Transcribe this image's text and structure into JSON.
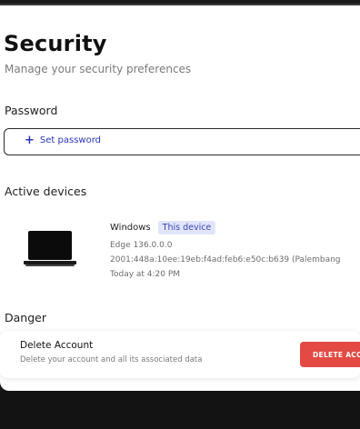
{
  "header": {
    "title": "Security",
    "subtitle": "Manage your security preferences"
  },
  "password": {
    "label": "Password",
    "button_icon": "plus-icon",
    "button_label": "Set password"
  },
  "devices": {
    "label": "Active devices",
    "items": [
      {
        "icon": "laptop-icon",
        "os": "Windows",
        "badge": "This device",
        "browser": "Edge 136.0.0.0",
        "ip_location": "2001:448a:10ee:19eb:f4ad:feb6:e50c:b639 (Palembang",
        "last_active": "Today at 4:20 PM"
      }
    ]
  },
  "danger": {
    "label": "Danger",
    "title": "Delete Account",
    "description": "Delete your account and all its associated data",
    "button_label": "DELETE ACCOUNT"
  },
  "colors": {
    "accent": "#3c46b6",
    "badge_bg": "#e1e5fb",
    "danger": "#e24a43"
  }
}
